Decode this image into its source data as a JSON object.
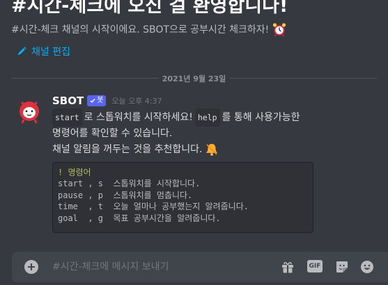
{
  "channel": {
    "welcome_title": "#시간-체크에 오신 걸 환영합니다!",
    "description": "#시간-체크 채널의 시작이에요. SBOT으로 공부시간 체크하자!",
    "edit_label": "채널 편집"
  },
  "divider": {
    "date": "2021년 9월 23일"
  },
  "message": {
    "author": "SBOT",
    "badge": "봇",
    "timestamp": "오늘 오후 4:37",
    "line1_code1": "start",
    "line1_text1": "로 스톱워치를 시작하세요!",
    "line1_code2": "help",
    "line1_text2": "를 통해 사용가능한",
    "line2": "명령어를 확인할 수 있습니다.",
    "line3": "채널 알림을 꺼두는 것을 추천합니다.",
    "codeblock": {
      "header": "! 명령어",
      "rows": [
        "start , s  스톱워치를 시작합니다.",
        "pause , p  스톱워치를 멈춥니다.",
        "time  , t  오늘 얼마나 공부했는지 알려줍니다.",
        "goal  , g  목표 공부시간을 알려줍니다."
      ]
    }
  },
  "composer": {
    "placeholder": "#시간-체크에 메시지 보내기",
    "gif_label": "GIF"
  },
  "colors": {
    "background": "#36393f",
    "link": "#00aff4",
    "bot_badge": "#5865f2",
    "composer": "#40444b"
  },
  "icons": [
    "alarm-clock-icon",
    "pencil-icon",
    "bot-avatar",
    "checkmark-icon",
    "bell-icon",
    "add-icon",
    "gift-icon",
    "gif-icon",
    "sticker-icon",
    "emoji-icon"
  ]
}
